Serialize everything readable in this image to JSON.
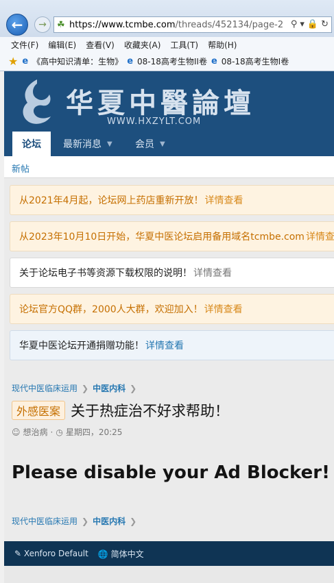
{
  "browser": {
    "url_scheme": "https://",
    "url_host": "www.tcmbe.com",
    "url_path": "/threads/452134/page-2",
    "menu": [
      "文件(F)",
      "编辑(E)",
      "查看(V)",
      "收藏夹(A)",
      "工具(T)",
      "帮助(H)"
    ],
    "favorites": [
      "《高中知识清单：生物》",
      "08-18高考生物II卷",
      "08-18高考生物Ⅰ卷"
    ]
  },
  "site": {
    "logo_title": "华夏中醫論壇",
    "logo_url": "WWW.HXZYLT.COM",
    "tabs": [
      "论坛",
      "最新消息",
      "会员"
    ],
    "subnav": "新帖"
  },
  "notices": [
    {
      "text": "从2021年4月起，论坛网上药店重新开放！",
      "more": "详情查看"
    },
    {
      "text": "从2023年10月10日开始，华夏中医论坛启用备用域名tcmbe.com",
      "more": "详情查看"
    },
    {
      "text": "关于论坛电子书等资源下载权限的说明！",
      "more": "详情查看"
    },
    {
      "text": "论坛官方QQ群，2000人大群，欢迎加入！",
      "more": "详情查看"
    },
    {
      "text": "华夏中医论坛开通捐赠功能！",
      "more": "详情查看"
    }
  ],
  "breadcrumb": [
    "现代中医临床运用",
    "中医内科"
  ],
  "thread": {
    "prefix": "外感医案",
    "title": "关于热症治不好求帮助！",
    "author": "想治病",
    "date": "星期四，20:25"
  },
  "adblock_message": "Please disable your Ad Blocker!",
  "footer": {
    "style": "Xenforo Default",
    "language": "简体中文"
  }
}
